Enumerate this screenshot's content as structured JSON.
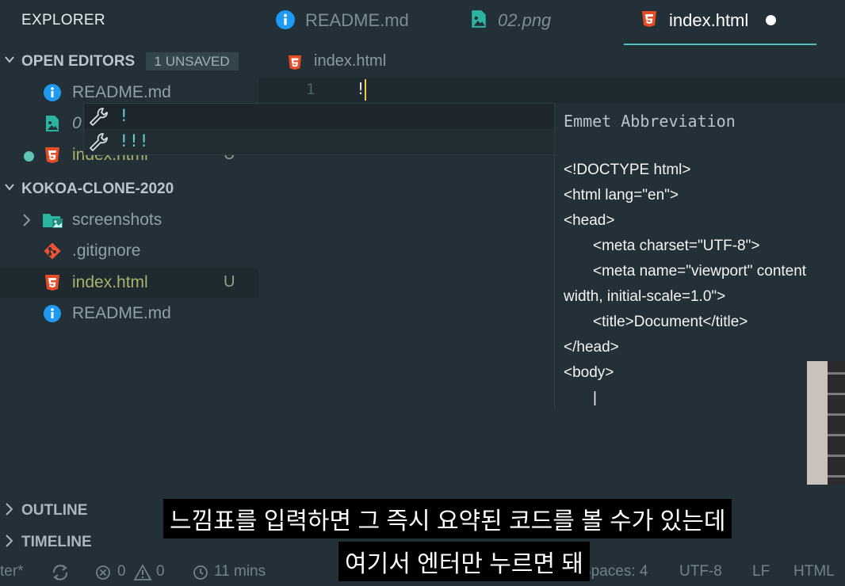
{
  "sidebar": {
    "title": "EXPLORER",
    "open_editors": {
      "label": "OPEN EDITORS",
      "badge": "1 UNSAVED",
      "files": [
        {
          "name": "README.md",
          "icon": "info-icon"
        },
        {
          "name": "02.png",
          "visible_text": "0",
          "icon": "image-icon"
        },
        {
          "name": "index.html",
          "icon": "html5-icon",
          "status": "U"
        }
      ]
    },
    "project": {
      "label": "KOKOA-CLONE-2020",
      "items": [
        {
          "name": "screenshots",
          "type": "folder",
          "icon": "image-folder-icon"
        },
        {
          "name": ".gitignore",
          "icon": "git-icon"
        },
        {
          "name": "index.html",
          "icon": "html5-icon",
          "status": "U"
        },
        {
          "name": "README.md",
          "icon": "info-icon"
        }
      ]
    },
    "outline_label": "OUTLINE",
    "timeline_label": "TIMELINE"
  },
  "tabs": [
    {
      "label": "README.md",
      "icon": "info-icon"
    },
    {
      "label": "02.png",
      "icon": "image-icon"
    },
    {
      "label": "index.html",
      "icon": "html5-icon",
      "active": true
    }
  ],
  "breadcrumb": "index.html",
  "editor": {
    "line_number": "1",
    "text": "!"
  },
  "suggest": {
    "items": [
      {
        "label": "!",
        "icon": "wrench-icon"
      },
      {
        "label": "!!!",
        "icon": "wrench-icon"
      }
    ]
  },
  "detail": {
    "title": "Emmet Abbreviation",
    "lines": [
      "<!DOCTYPE html>",
      "<html lang=\"en\">",
      "<head>",
      "<meta charset=\"UTF-8\">",
      "<meta name=\"viewport\" content",
      "width, initial-scale=1.0\">",
      "<title>Document</title>",
      "</head>",
      "<body>",
      "|"
    ]
  },
  "statusbar": {
    "left_text": "ter*",
    "errors": "0",
    "warnings": "0",
    "time": "11 mins",
    "spaces": "Spaces: 4",
    "encoding": "UTF-8",
    "eol": "LF",
    "language": "HTML"
  },
  "subtitles": {
    "line1": "느낌표를 입력하면 그 즉시 요약된 코드를 볼 수가 있는데",
    "line2": "여기서 엔터만 누르면 돼"
  },
  "colors": {
    "background": "#243038",
    "accent": "#4ec3b4",
    "html_icon": "#e44d26",
    "info_icon": "#1e9bf0",
    "image_icon": "#2bb5a0",
    "git_icon": "#f05133",
    "cursor": "#f7c948"
  }
}
